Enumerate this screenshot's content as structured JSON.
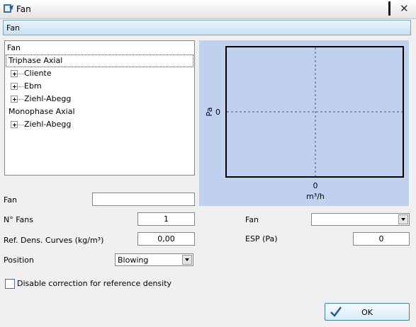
{
  "window": {
    "title": "Fan"
  },
  "header": {
    "label": "Fan"
  },
  "tree": {
    "root": "Fan",
    "group1": "Triphase Axial",
    "g1_items": [
      "Cliente",
      "Ebm",
      "Ziehl-Abegg"
    ],
    "group2": "Monophase Axial",
    "g2_items": [
      "Ziehl-Abegg"
    ]
  },
  "chart_data": {
    "type": "line",
    "series": [],
    "ylabel": "Pa",
    "xlabel": "m³/h",
    "y_tick": "0",
    "x_tick": "0",
    "grid": "dashed crosshair at 0"
  },
  "form": {
    "fan_label": "Fan",
    "fan_value": "",
    "nfans_label": "N° Fans",
    "nfans_value": "1",
    "refdens_label": "Ref. Dens. Curves (kg/m³)",
    "refdens_value": "0,00",
    "position_label": "Position",
    "position_value": "Blowing",
    "fan2_label": "Fan",
    "fan2_value": "",
    "esp_label": "ESP (Pa)",
    "esp_value": "0",
    "disable_label": "Disable correction for reference density",
    "disable_checked": false
  },
  "ok_label": "OK",
  "colors": {
    "chart_bg": "#c0d1ef",
    "accent": "#3c7fb1"
  }
}
